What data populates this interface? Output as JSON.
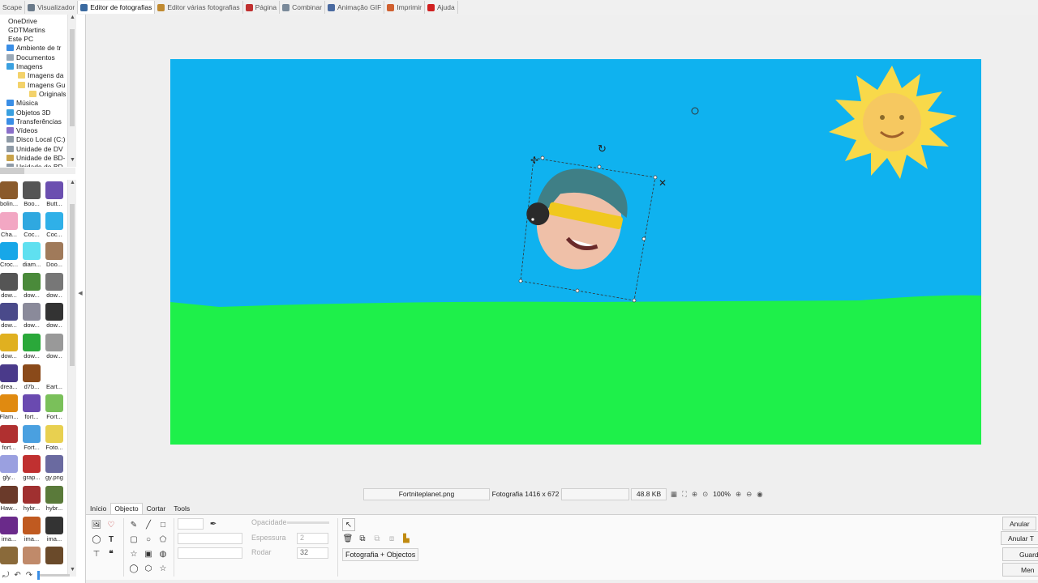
{
  "top_tabs": [
    {
      "label": "Scape",
      "icon": "",
      "active": false
    },
    {
      "label": "Visualizador",
      "icon": "viewer-icon",
      "active": false
    },
    {
      "label": "Editor de fotografias",
      "icon": "editor-icon",
      "active": true
    },
    {
      "label": "Editor várias fotografias",
      "icon": "batch-editor-icon",
      "active": false
    },
    {
      "label": "Página",
      "icon": "page-icon",
      "active": false
    },
    {
      "label": "Combinar",
      "icon": "combine-icon",
      "active": false
    },
    {
      "label": "Animação GIF",
      "icon": "gif-icon",
      "active": false
    },
    {
      "label": "Imprimir",
      "icon": "print-icon",
      "active": false
    },
    {
      "label": "Ajuda",
      "icon": "help-icon",
      "active": false
    }
  ],
  "tree": [
    {
      "label": "OneDrive",
      "indent": 0,
      "color": "#3a8ee6"
    },
    {
      "label": "GDTMartins",
      "indent": 0,
      "color": "#e8c36a"
    },
    {
      "label": "Este PC",
      "indent": 0,
      "color": "#6aa5d8"
    },
    {
      "label": "Ambiente de tr",
      "indent": 1,
      "color": "#3a8ee6"
    },
    {
      "label": "Documentos",
      "indent": 1,
      "color": "#9aa9b8"
    },
    {
      "label": "Imagens",
      "indent": 1,
      "color": "#3aa0e0"
    },
    {
      "label": "Imagens da",
      "indent": 2,
      "color": "#f3d26b"
    },
    {
      "label": "Imagens Gu",
      "indent": 2,
      "color": "#f3d26b"
    },
    {
      "label": "Originals",
      "indent": 3,
      "color": "#f3d26b"
    },
    {
      "label": "Música",
      "indent": 1,
      "color": "#3a8ee6"
    },
    {
      "label": "Objetos 3D",
      "indent": 1,
      "color": "#3aa0e0"
    },
    {
      "label": "Transferências",
      "indent": 1,
      "color": "#3a8ee6"
    },
    {
      "label": "Vídeos",
      "indent": 1,
      "color": "#8a6fc9"
    },
    {
      "label": "Disco Local (C:)",
      "indent": 1,
      "color": "#8e9aa6"
    },
    {
      "label": "Unidade de DV",
      "indent": 1,
      "color": "#8e9aa6"
    },
    {
      "label": "Unidade de BD-",
      "indent": 1,
      "color": "#c9a34a"
    },
    {
      "label": "Unidade de BD",
      "indent": 1,
      "color": "#8e9aa6"
    }
  ],
  "thumbnails": [
    {
      "label": "bolin...",
      "color": "#8a5a2b"
    },
    {
      "label": "Boo...",
      "color": "#555555"
    },
    {
      "label": "Butt...",
      "color": "#6b4fb0"
    },
    {
      "label": "Cha...",
      "color": "#f2a7c3"
    },
    {
      "label": "Coc...",
      "color": "#2fa8e0"
    },
    {
      "label": "Coc...",
      "color": "#2fb0e8"
    },
    {
      "label": "Croc...",
      "color": "#17a7e8"
    },
    {
      "label": "diam...",
      "color": "#5fe0f0"
    },
    {
      "label": "Doo...",
      "color": "#a07a5a"
    },
    {
      "label": "dow...",
      "color": "#555555"
    },
    {
      "label": "dow...",
      "color": "#4a8a3a"
    },
    {
      "label": "dow...",
      "color": "#777777"
    },
    {
      "label": "dow...",
      "color": "#4a4a8a"
    },
    {
      "label": "dow...",
      "color": "#8a8a9a"
    },
    {
      "label": "dow...",
      "color": "#333333"
    },
    {
      "label": "dow...",
      "color": "#e0b020"
    },
    {
      "label": "dow...",
      "color": "#2aa83a"
    },
    {
      "label": "dow...",
      "color": "#999999"
    },
    {
      "label": "drea...",
      "color": "#4a3a8a"
    },
    {
      "label": "d7b...",
      "color": "#8a4a1a"
    },
    {
      "label": "Eart...",
      "color": "#ffffff"
    },
    {
      "label": "Flam...",
      "color": "#e08a10"
    },
    {
      "label": "fort...",
      "color": "#6a4ab0"
    },
    {
      "label": "Fort...",
      "color": "#7ac05a"
    },
    {
      "label": "fort...",
      "color": "#b03030"
    },
    {
      "label": "Fort...",
      "color": "#4aa0e0"
    },
    {
      "label": "Foto...",
      "color": "#e8d050"
    },
    {
      "label": "gly...",
      "color": "#9aa0e0"
    },
    {
      "label": "grap...",
      "color": "#c03030"
    },
    {
      "label": "gy.png",
      "color": "#6a6aa0"
    },
    {
      "label": "Haw...",
      "color": "#6a3a2a"
    },
    {
      "label": "hybr...",
      "color": "#a03030"
    },
    {
      "label": "hybr...",
      "color": "#5a7a3a"
    },
    {
      "label": "ima...",
      "color": "#6a2a8a"
    },
    {
      "label": "ima...",
      "color": "#c05a20"
    },
    {
      "label": "ima...",
      "color": "#333333"
    },
    {
      "label": "",
      "color": "#8a6a3a"
    },
    {
      "label": "",
      "color": "#c08a6a"
    },
    {
      "label": "",
      "color": "#6a4a2a"
    }
  ],
  "status": {
    "filename": "Fortniteplanet.png",
    "info": "Fotografia 1416 x 672",
    "size": "48.8 KB",
    "zoom": "100%"
  },
  "ribbon_tabs": [
    {
      "label": "Início",
      "active": false
    },
    {
      "label": "Objecto",
      "active": true
    },
    {
      "label": "Cortar",
      "active": false
    },
    {
      "label": "Tools",
      "active": false
    }
  ],
  "ribbon": {
    "opacity_label": "Opacidade",
    "thickness_label": "Espessura",
    "thickness_value": "2",
    "rotate_label": "Rodar",
    "rotate_value": "32",
    "photo_objects_button": "Fotografia + Objectos"
  },
  "right_buttons": [
    "Anular",
    "Anular T",
    "Guard",
    "Men"
  ],
  "colors": {
    "sky": "#0fb2ef",
    "grass": "#1ef04a",
    "sun": "#f8d94a"
  }
}
